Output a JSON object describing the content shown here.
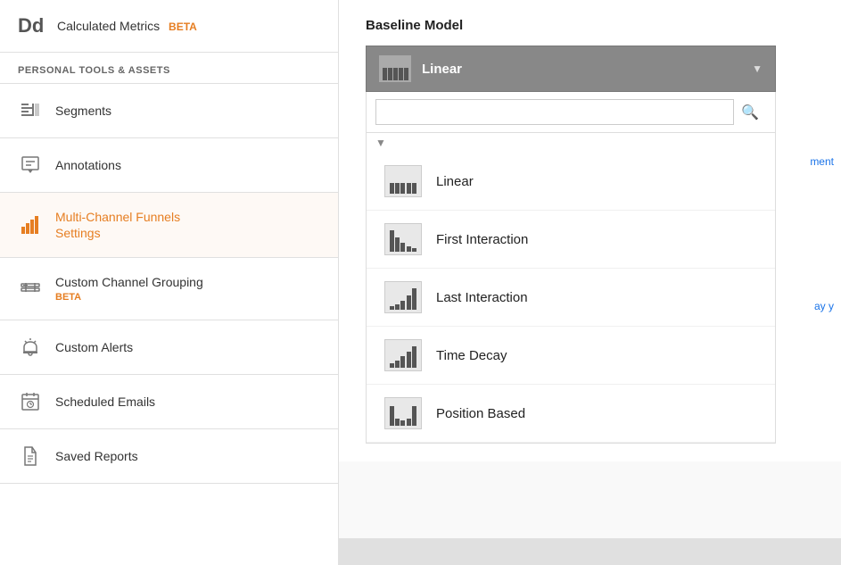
{
  "sidebar": {
    "top_item": {
      "icon": "Dd",
      "label": "Calculated Metrics",
      "beta": "BETA"
    },
    "section_header": "PERSONAL TOOLS & ASSETS",
    "items": [
      {
        "id": "segments",
        "label": "Segments",
        "beta": null,
        "active": false,
        "icon": "segments"
      },
      {
        "id": "annotations",
        "label": "Annotations",
        "beta": null,
        "active": false,
        "icon": "annotations"
      },
      {
        "id": "multi-channel",
        "label": "Multi-Channel Funnels\nSettings",
        "label_line1": "Multi-Channel Funnels",
        "label_line2": "Settings",
        "beta": null,
        "active": true,
        "icon": "multichannel"
      },
      {
        "id": "custom-channel",
        "label": "Custom Channel Grouping",
        "beta": "BETA",
        "active": false,
        "icon": "custom-channel"
      },
      {
        "id": "custom-alerts",
        "label": "Custom Alerts",
        "beta": null,
        "active": false,
        "icon": "alerts"
      },
      {
        "id": "scheduled-emails",
        "label": "Scheduled Emails",
        "beta": null,
        "active": false,
        "icon": "scheduled"
      },
      {
        "id": "saved-reports",
        "label": "Saved Reports",
        "beta": null,
        "active": false,
        "icon": "saved"
      }
    ]
  },
  "main": {
    "baseline_model": {
      "title": "Baseline Model",
      "selected": "Linear",
      "search_placeholder": "",
      "options": [
        {
          "id": "linear",
          "label": "Linear",
          "bars": [
            2,
            2,
            2,
            2,
            2
          ]
        },
        {
          "id": "first-interaction",
          "label": "First Interaction",
          "bars": [
            5,
            2,
            1,
            1,
            1
          ]
        },
        {
          "id": "last-interaction",
          "label": "Last Interaction",
          "bars": [
            1,
            1,
            1,
            2,
            5
          ]
        },
        {
          "id": "time-decay",
          "label": "Time Decay",
          "bars": [
            1,
            1,
            2,
            3,
            5
          ]
        },
        {
          "id": "position-based",
          "label": "Position Based",
          "bars": [
            4,
            1,
            1,
            1,
            4
          ]
        }
      ]
    }
  }
}
